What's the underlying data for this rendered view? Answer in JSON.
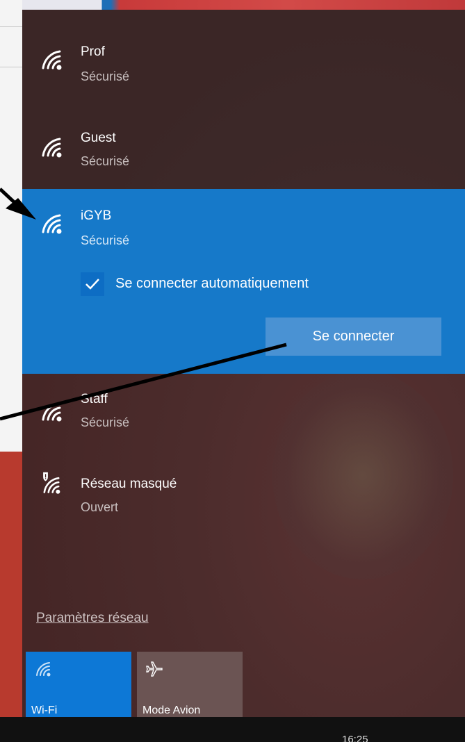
{
  "networks": [
    {
      "name": "Prof",
      "status": "Sécurisé"
    },
    {
      "name": "Guest",
      "status": "Sécurisé"
    },
    {
      "name": "iGYB",
      "status": "Sécurisé",
      "selected": true
    },
    {
      "name": "Staff",
      "status": "Sécurisé"
    },
    {
      "name": "Réseau masqué",
      "status": "Ouvert",
      "hidden_shield": true
    }
  ],
  "selected_network": {
    "auto_connect_label": "Se connecter automatiquement",
    "auto_connect_checked": true,
    "connect_button": "Se connecter"
  },
  "settings_link": "Paramètres réseau",
  "quick_actions": [
    {
      "label": "Wi-Fi",
      "icon": "wifi-icon",
      "active": true
    },
    {
      "label": "Mode Avion",
      "icon": "airplane-icon",
      "active": false
    }
  ],
  "taskbar": {
    "clock": "16:25"
  },
  "colors": {
    "accent": "#1679c9",
    "tile_active": "#0d78d6",
    "tile_inactive": "#6b5453",
    "panel_bg": "#452626"
  }
}
